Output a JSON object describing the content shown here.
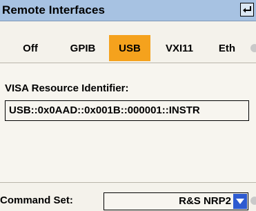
{
  "window": {
    "title": "Remote Interfaces",
    "enter_icon": "enter-return-icon"
  },
  "tabs": [
    {
      "label": "Off",
      "active": false
    },
    {
      "label": "GPIB",
      "active": false
    },
    {
      "label": "USB",
      "active": true
    },
    {
      "label": "VXI11",
      "active": false
    },
    {
      "label": "Eth",
      "active": false
    }
  ],
  "visa": {
    "label": "VISA Resource Identifier:",
    "value": "USB::0x0AAD::0x001B::000001::INSTR"
  },
  "command_set": {
    "label": "Command Set:",
    "value": "R&S NRP2",
    "dropdown_icon": "chevron-down-icon"
  },
  "colors": {
    "titlebar": "#a7c2e2",
    "active_tab": "#f5a21d",
    "dropdown_button": "#2e5bd0",
    "background": "#f7f5ef"
  }
}
